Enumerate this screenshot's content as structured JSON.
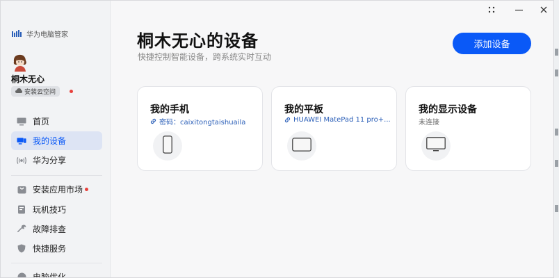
{
  "app": {
    "name": "华为电脑管家"
  },
  "user": {
    "name": "桐木无心",
    "cloud_label": "安装云空间"
  },
  "nav": {
    "group1": [
      {
        "label": "首页",
        "icon": "monitor-icon"
      },
      {
        "label": "我的设备",
        "icon": "devices-icon",
        "active": true
      },
      {
        "label": "华为分享",
        "icon": "share-wave-icon"
      }
    ],
    "group2": [
      {
        "label": "安装应用市场",
        "icon": "store-bag-icon",
        "dot": true
      },
      {
        "label": "玩机技巧",
        "icon": "tips-book-icon"
      },
      {
        "label": "故障排查",
        "icon": "wrench-icon"
      },
      {
        "label": "快捷服务",
        "icon": "shield-icon"
      }
    ],
    "group3": [
      {
        "label": "电脑优化",
        "icon": "optimize-icon"
      }
    ]
  },
  "header": {
    "title": "桐木无心的设备",
    "subtitle": "快捷控制智能设备，跨系统实时互动",
    "add_button": "添加设备"
  },
  "devices": [
    {
      "title": "我的手机",
      "status": "密码：caixitongtaishuaila",
      "icon": "phone-icon"
    },
    {
      "title": "我的平板",
      "status": "HUAWEI MatePad 11 pro+...",
      "icon": "tablet-icon"
    },
    {
      "title": "我的显示设备",
      "status": "未连接",
      "icon": "display-icon"
    }
  ],
  "colors": {
    "accent": "#0a59f7",
    "active_bg": "#dde4f4",
    "dot": "#e8403b"
  }
}
